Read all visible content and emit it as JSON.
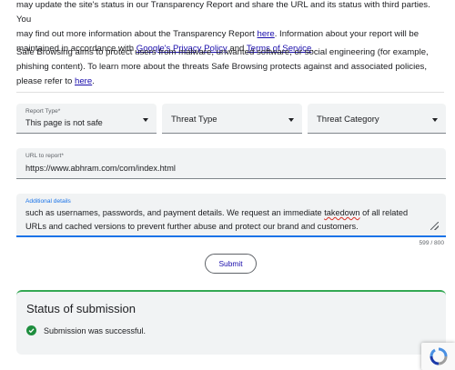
{
  "intro": {
    "line1": "may update the site's status in our Transparency Report and share the URL and its status with third parties. You",
    "line2_a": "may find out more information about the Transparency Report ",
    "line2_link": "here",
    "line2_b": ". Information about your report will be",
    "line3_a": "maintained in accordance with ",
    "line3_link1": "Google's Privacy Policy",
    "line3_mid": " and ",
    "line3_link2": "Terms of Service",
    "line3_b": "."
  },
  "safe_browsing": {
    "line1": "Safe Browsing aims to protect users from malware, unwanted software, or social engineering (for example,",
    "line2": "phishing content). To learn more about the threats Safe Browsing protects against and associated policies,",
    "line3_a": "please refer to ",
    "line3_link": "here",
    "line3_b": "."
  },
  "form": {
    "report_type": {
      "label": "Report Type*",
      "value": "This page is not safe"
    },
    "threat_type": {
      "placeholder": "Threat Type"
    },
    "threat_category": {
      "placeholder": "Threat Category"
    },
    "url": {
      "label": "URL to report*",
      "value": "https://www.abhram.com/com/index.html"
    },
    "details": {
      "label": "Additional details",
      "line1_a": "such as usernames, passwords, and payment details. We request an immediate ",
      "line1_misspelled": "takedown",
      "line1_b": " of all related",
      "line2": "URLs and cached versions to prevent further abuse and protect our brand and customers."
    },
    "counter": "599 / 800",
    "submit_label": "Submit"
  },
  "status": {
    "title": "Status of submission",
    "message": "Submission was successful."
  },
  "colors": {
    "link": "#1a0dab",
    "success_green": "#1e8e3e",
    "status_border": "#34a853",
    "focus_blue": "#1a73e8",
    "field_bg": "#f1f3f4"
  },
  "icons": [
    "dropdown-caret-icon",
    "resize-handle-icon",
    "success-check-icon",
    "recaptcha-icon"
  ]
}
